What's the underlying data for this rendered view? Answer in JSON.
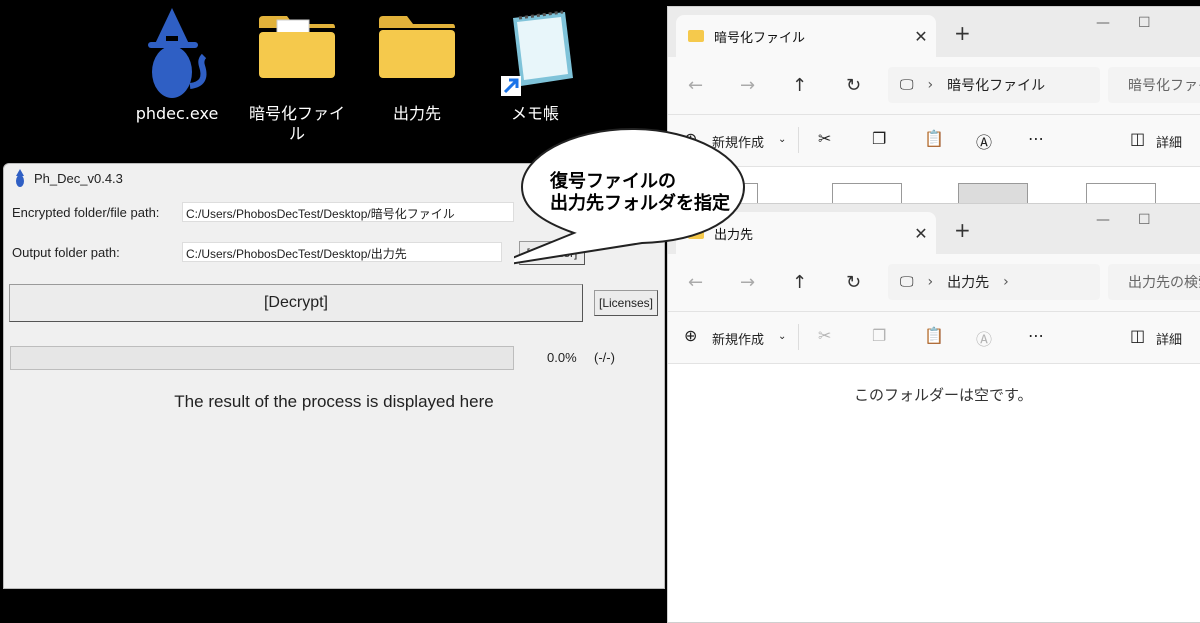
{
  "desktop": {
    "icons": [
      {
        "label": "phdec.exe",
        "icon": "witch-cat-icon"
      },
      {
        "label": "暗号化ファイル",
        "icon": "folder-with-document-icon"
      },
      {
        "label": "出力先",
        "icon": "folder-icon"
      },
      {
        "label": "メモ帳",
        "icon": "notepad-shortcut-icon"
      }
    ]
  },
  "explorer_top": {
    "tab_title": "暗号化ファイル",
    "address": "暗号化ファイル",
    "search_placeholder": "暗号化ファイ",
    "new_label": "新規作成",
    "details_label": "詳細",
    "files": 4
  },
  "explorer_bottom": {
    "tab_title": "出力先",
    "address": "出力先",
    "search_placeholder": "出力先の検索",
    "new_label": "新規作成",
    "details_label": "詳細",
    "empty_text": "このフォルダーは空です。"
  },
  "phdec": {
    "title": "Ph_Dec_v0.4.3",
    "encrypted_label": "Encrypted folder/file path:",
    "encrypted_value": "C:/Users/PhobosDecTest/Desktop/暗号化ファイル",
    "output_label": "Output folder path:",
    "output_value": "C:/Users/PhobosDecTest/Desktop/出力先",
    "folder_button": "[...Folder]",
    "decrypt_button": "[Decrypt]",
    "licenses_button": "[Licenses]",
    "progress_fraction": 0.0,
    "progress_text": "0.0%",
    "count_text": "(-/-)",
    "result_text": "The result of the process is displayed here"
  },
  "callout": {
    "line1": "復号ファイルの",
    "line2": "出力先フォルダを指定"
  },
  "colors": {
    "folder_yellow": "#f5c94c",
    "wizard_blue": "#2f5fc4",
    "callout_fill": "#ffffff"
  }
}
